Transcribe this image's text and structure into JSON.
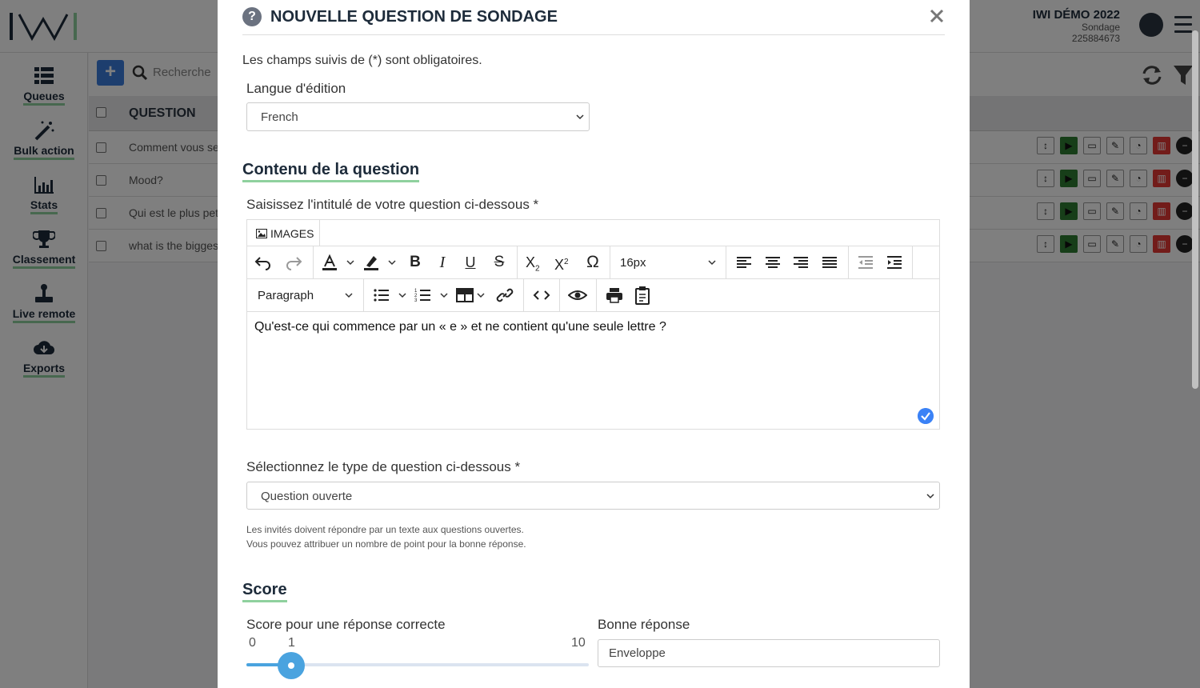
{
  "app": {
    "title_line": "IWI DÉMO 2022",
    "sub_line": "Sondage",
    "id_line": "225884673",
    "sidebar": [
      {
        "label": "Queues",
        "icon": "list-icon"
      },
      {
        "label": "Bulk action",
        "icon": "magic-wand-icon"
      },
      {
        "label": "Stats",
        "icon": "bar-chart-icon"
      },
      {
        "label": "Classement",
        "icon": "trophy-icon"
      },
      {
        "label": "Live remote",
        "icon": "joystick-icon"
      },
      {
        "label": "Exports",
        "icon": "cloud-download-icon"
      }
    ],
    "search_placeholder": "Recherche",
    "table_header": "QUESTION",
    "rows": [
      "Comment vous se",
      "Mood?",
      "Qui est le plus pet",
      "what is the bigges"
    ]
  },
  "modal": {
    "title": "NOUVELLE QUESTION DE SONDAGE",
    "required_note": "Les champs suivis de (*) sont obligatoires.",
    "lang_label": "Langue d'édition",
    "lang_value": "French",
    "section_content": "Contenu de la question",
    "question_label": "Saisissez l'intitulé de votre question ci-dessous *",
    "editor": {
      "images_label": "IMAGES",
      "font_size": "16px",
      "block_format": "Paragraph",
      "content": "Qu'est-ce qui commence par un « e » et ne contient qu'une seule lettre ?"
    },
    "type_label": "Sélectionnez le type de question ci-dessous *",
    "type_value": "Question ouverte",
    "type_help_1": "Les invités doivent répondre par un texte aux questions ouvertes.",
    "type_help_2": "Vous pouvez attribuer un nombre de point pour la bonne réponse.",
    "section_score": "Score",
    "score_label": "Score pour une réponse correcte",
    "score_min": "0",
    "score_value": "1",
    "score_max": "10",
    "answer_label": "Bonne réponse",
    "answer_value": "Enveloppe"
  },
  "colors": {
    "accent_blue": "#3b7ddd",
    "underline_green": "#8fd19e",
    "slider_blue": "#4aa3df"
  }
}
